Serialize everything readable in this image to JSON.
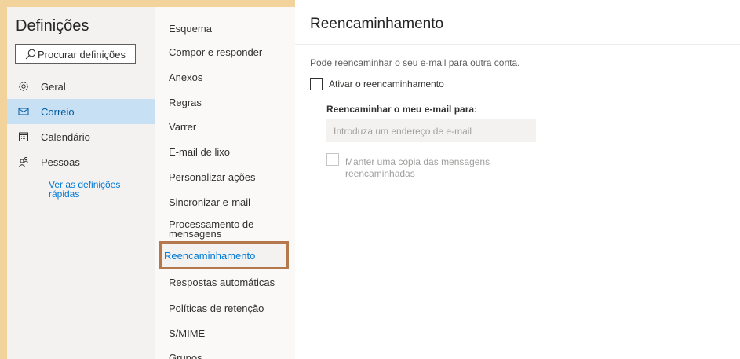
{
  "settings": {
    "title": "Definições",
    "search": {
      "placeholder": "Procurar definições"
    },
    "categories": [
      {
        "label": "Geral",
        "icon": "gear-icon"
      },
      {
        "label": "Correio",
        "icon": "mail-icon",
        "selected": true
      },
      {
        "label": "Calendário",
        "icon": "calendar-icon"
      },
      {
        "label": "Pessoas",
        "icon": "people-icon"
      }
    ],
    "quick_settings_link": "Ver as definições rápidas"
  },
  "mail_menu": {
    "items": [
      "Esquema",
      "Compor e responder",
      "Anexos",
      "Regras",
      "Varrer",
      "E-mail de lixo",
      "Personalizar ações",
      "Sincronizar e-mail",
      "Processamento de mensagens",
      "Reencaminhamento",
      "Respostas automáticas",
      "Políticas de retenção",
      "S/MIME",
      "Grupos"
    ],
    "selected_index": 9
  },
  "forwarding": {
    "title": "Reencaminhamento",
    "description": "Pode reencaminhar o seu e-mail para outra conta.",
    "enable_label": "Ativar o reencaminhamento",
    "forward_to_label": "Reencaminhar o meu e-mail para:",
    "email_placeholder": "Introduza um endereço de e-mail",
    "keep_copy_label": "Manter uma cópia das mensagens reencaminhadas"
  },
  "colors": {
    "accent": "#0078d4",
    "highlight_border": "#b5784d",
    "backdrop": "#f2d39b"
  }
}
